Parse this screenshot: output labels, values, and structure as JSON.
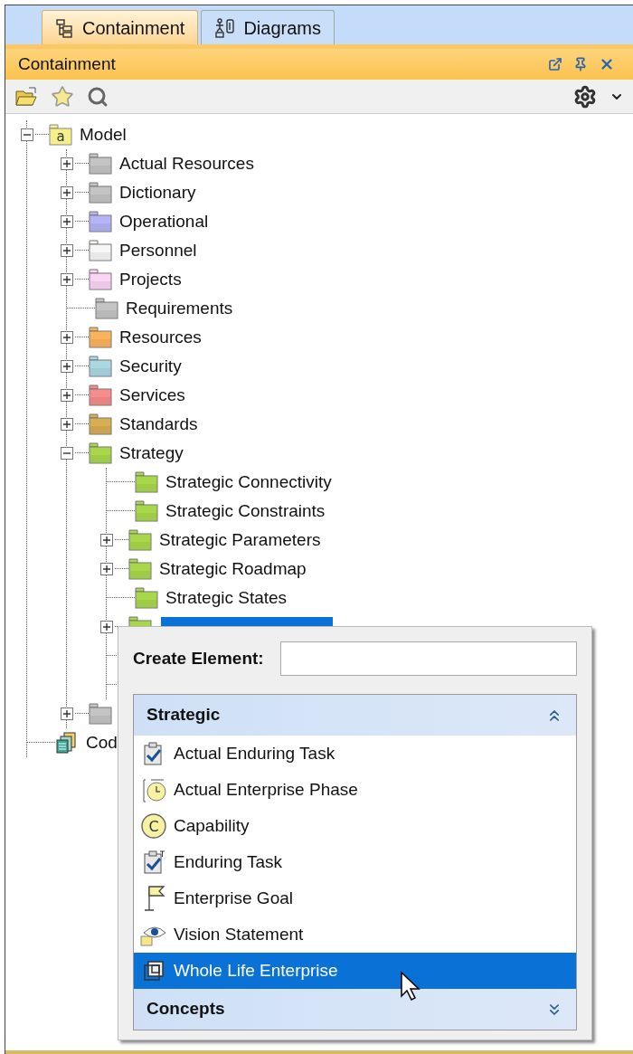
{
  "tabs": [
    {
      "label": "Containment",
      "kind": "containment",
      "selected": true
    },
    {
      "label": "Diagrams",
      "kind": "diagrams",
      "selected": false
    }
  ],
  "panel": {
    "title": "Containment"
  },
  "tree": [
    {
      "label": "Model",
      "kind": "model",
      "icon_label": "a",
      "expanded": true,
      "children": [
        {
          "label": "Actual Resources",
          "kind": "folder",
          "color": "#c4c4c4",
          "expanded": false
        },
        {
          "label": "Dictionary",
          "kind": "folder",
          "color": "#c4c4c4",
          "expanded": false
        },
        {
          "label": "Operational",
          "kind": "folder",
          "color": "#b4b4f6",
          "expanded": false
        },
        {
          "label": "Personnel",
          "kind": "folder",
          "color": "#f7f7f7",
          "expanded": false
        },
        {
          "label": "Projects",
          "kind": "folder",
          "color": "#fcd4f6",
          "expanded": false
        },
        {
          "label": "Requirements",
          "kind": "folder",
          "color": "#c4c4c4"
        },
        {
          "label": "Resources",
          "kind": "folder",
          "color": "#fdb35c",
          "expanded": false
        },
        {
          "label": "Security",
          "kind": "folder",
          "color": "#acd8e4",
          "expanded": false
        },
        {
          "label": "Services",
          "kind": "folder",
          "color": "#f68c8c",
          "expanded": false
        },
        {
          "label": "Standards",
          "kind": "folder",
          "color": "#d8ae52",
          "expanded": false
        },
        {
          "label": "Strategy",
          "kind": "folder",
          "color": "#a8d84a",
          "expanded": true,
          "children": [
            {
              "label": "Strategic Connectivity",
              "kind": "folder",
              "color": "#a8d84a"
            },
            {
              "label": "Strategic Constraints",
              "kind": "folder",
              "color": "#a8d84a"
            },
            {
              "label": "Strategic Parameters",
              "kind": "folder",
              "color": "#a8d84a",
              "expanded": false
            },
            {
              "label": "Strategic Roadmap",
              "kind": "folder",
              "color": "#a8d84a",
              "expanded": false
            },
            {
              "label": "Strategic States",
              "kind": "folder",
              "color": "#a8d84a"
            },
            {
              "kind": "folder",
              "color": "#a8d84a",
              "expanded": false,
              "selected": true
            },
            {
              "kind": "hidden"
            },
            {
              "kind": "hidden"
            }
          ]
        },
        {
          "kind": "folder",
          "color": "#c4c4c4",
          "expanded": false
        }
      ]
    },
    {
      "label": "Cod",
      "kind": "code"
    }
  ],
  "popup": {
    "label": "Create Element:",
    "sections": [
      {
        "title": "Strategic",
        "expanded": true,
        "items": [
          {
            "label": "Actual Enduring Task",
            "kind": "task",
            "selected": false
          },
          {
            "label": "Actual Enterprise Phase",
            "kind": "phase",
            "selected": false
          },
          {
            "label": "Capability",
            "kind": "capability",
            "icon_label": "C",
            "selected": false
          },
          {
            "label": "Enduring Task",
            "kind": "enduring-task",
            "selected": false
          },
          {
            "label": "Enterprise Goal",
            "kind": "goal",
            "selected": false
          },
          {
            "label": "Vision Statement",
            "kind": "vision",
            "selected": false
          },
          {
            "label": "Whole Life Enterprise",
            "kind": "enterprise",
            "selected": true
          }
        ]
      },
      {
        "title": "Concepts",
        "expanded": false
      }
    ]
  }
}
